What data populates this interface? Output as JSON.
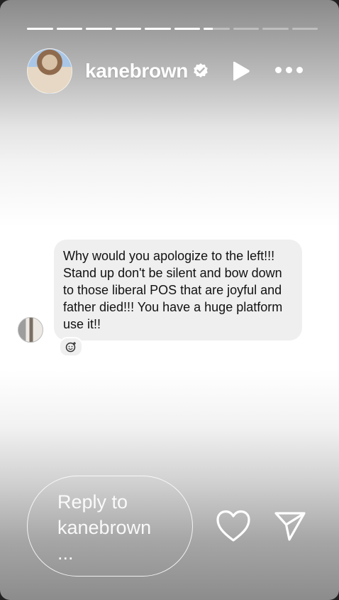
{
  "story": {
    "progress_segments": [
      1,
      1,
      1,
      1,
      1,
      1,
      0.35,
      0,
      0,
      0
    ]
  },
  "header": {
    "username": "kanebrown",
    "verified": true,
    "play_icon": "play-icon",
    "more_icon": "more-icon"
  },
  "message": {
    "text": "Why would you apologize to the left!!! Stand up don't be silent and bow down to those liberal POS that are joyful and father died!!! You have a huge platform use it!!",
    "reaction_icon": "emoji-add-icon"
  },
  "footer": {
    "reply_placeholder": "Reply to\nkanebrown\n...",
    "heart_icon": "heart-icon",
    "send_icon": "send-icon"
  },
  "colors": {
    "bubble": "#efefef",
    "text": "#111111",
    "ui_white": "#ffffff"
  }
}
